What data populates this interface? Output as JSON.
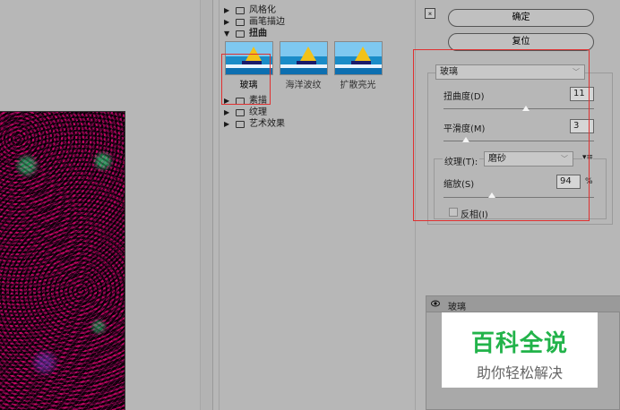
{
  "gallery": {
    "categories_top": [
      {
        "label": "风格化",
        "expanded": false
      },
      {
        "label": "画笔描边",
        "expanded": false
      }
    ],
    "distort": {
      "label": "扭曲",
      "expanded": true
    },
    "thumbnails": [
      {
        "label": "玻璃",
        "selected": true
      },
      {
        "label": "海洋波纹",
        "selected": false
      },
      {
        "label": "扩散亮光",
        "selected": false
      }
    ],
    "categories_bottom": [
      {
        "label": "素描",
        "expanded": false
      },
      {
        "label": "纹理",
        "expanded": false
      },
      {
        "label": "艺术效果",
        "expanded": false
      }
    ]
  },
  "panel": {
    "collapse_icon": "⌅",
    "ok_label": "确定",
    "reset_label": "复位",
    "filter_select": "玻璃",
    "distortion_label": "扭曲度(D)",
    "distortion_value": "11",
    "distortion_fraction": 0.55,
    "smoothness_label": "平滑度(M)",
    "smoothness_value": "3",
    "smoothness_fraction": 0.15,
    "texture_label": "纹理(T):",
    "texture_select": "磨砂",
    "texture_menu_icon": "▾≡",
    "scale_label": "缩放(S)",
    "scale_value": "94",
    "scale_unit": "%",
    "scale_fraction": 0.32,
    "invert_label": "反相(I)",
    "invert_checked": false
  },
  "layers": {
    "layer_name": "玻璃"
  },
  "watermark": {
    "title": "百科全说",
    "subtitle": "助你轻松解决"
  },
  "colors": {
    "highlight_red": "#e03030",
    "watermark_green": "#22b34a"
  }
}
